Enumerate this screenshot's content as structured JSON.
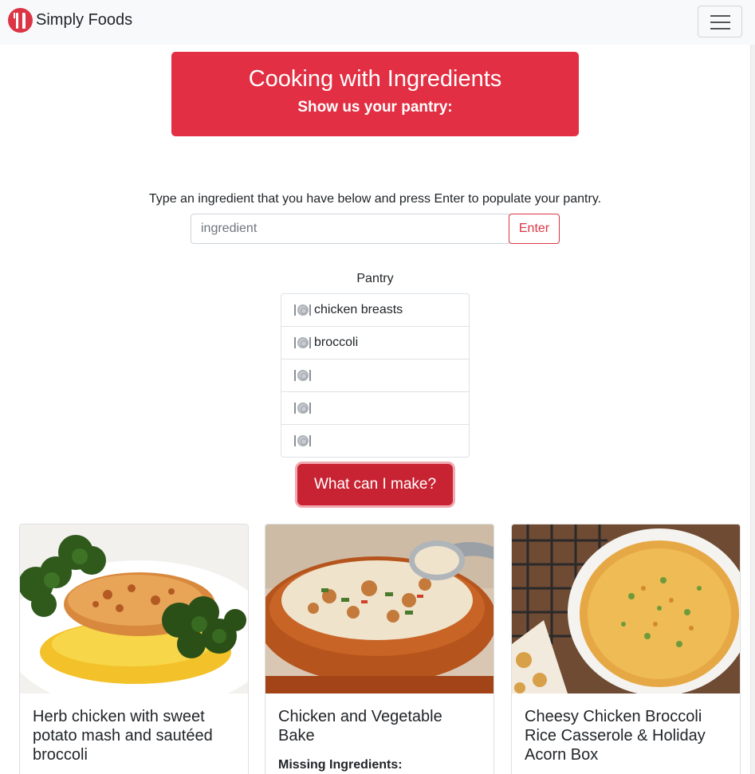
{
  "navbar": {
    "brand": "Simply Foods",
    "logo_icon": "fork-knife-logo-icon",
    "menu_icon": "hamburger-menu-icon",
    "bg_color": "#f8f9fa"
  },
  "hero": {
    "title": "Cooking with Ingredients",
    "subtitle": "Show us your pantry:",
    "bg_color": "#e22f43"
  },
  "form": {
    "instructions": "Type an ingredient that you have below and press Enter to populate your pantry.",
    "placeholder": "ingredient",
    "value": "",
    "enter_label": "Enter"
  },
  "pantry": {
    "title": "Pantry",
    "item_icon": "plate-cutlery-icon",
    "items": [
      "chicken breasts",
      "broccoli",
      "",
      "",
      ""
    ]
  },
  "actions": {
    "make_label": "What can I make?",
    "accent_color": "#c82333"
  },
  "recipes": [
    {
      "title": "Herb chicken with sweet potato mash and sautéed broccoli",
      "missing_label": "",
      "image": "herb-chicken-photo"
    },
    {
      "title": "Chicken and Vegetable Bake",
      "missing_label": "Missing Ingredients:",
      "image": "chicken-vegetable-bake-photo"
    },
    {
      "title": "Cheesy Chicken Broccoli Rice Casserole & Holiday Acorn Box",
      "missing_label": "",
      "image": "broccoli-casserole-photo"
    }
  ]
}
